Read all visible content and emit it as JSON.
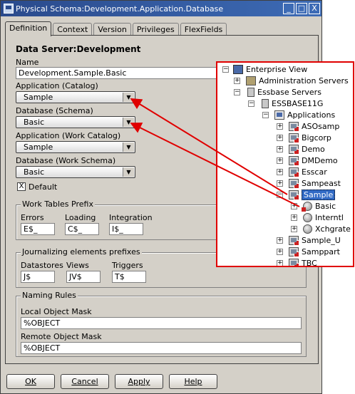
{
  "window": {
    "title": "Physical Schema:Development.Application.Database",
    "minimize": "_",
    "maximize": "□",
    "close": "X"
  },
  "tabs": [
    "Definition",
    "Context",
    "Version",
    "Privileges",
    "FlexFields"
  ],
  "form": {
    "heading": "Data Server:Development",
    "name_label": "Name",
    "name_value": "Development.Sample.Basic",
    "app_catalog_label": "Application (Catalog)",
    "app_catalog_value": "Sample",
    "db_schema_label": "Database (Schema)",
    "db_schema_value": "Basic",
    "app_work_catalog_label": "Application (Work Catalog)",
    "app_work_catalog_value": "Sample",
    "db_work_schema_label": "Database (Work Schema)",
    "db_work_schema_value": "Basic",
    "default_label": "Default",
    "default_checked": "X"
  },
  "work_tables": {
    "title": "Work Tables Prefix",
    "errors_label": "Errors",
    "errors_value": "E$_",
    "loading_label": "Loading",
    "loading_value": "C$_",
    "integration_label": "Integration",
    "integration_value": "I$_"
  },
  "journalizing": {
    "title": "Journalizing elements prefixes",
    "datastores_label": "Datastores",
    "datastores_value": "J$",
    "views_label": "Views",
    "views_value": "JV$",
    "triggers_label": "Triggers",
    "triggers_value": "T$"
  },
  "naming": {
    "title": "Naming Rules",
    "local_label": "Local Object Mask",
    "local_value": "%OBJECT",
    "remote_label": "Remote Object Mask",
    "remote_value": "%OBJECT"
  },
  "buttons": {
    "ok": "OK",
    "cancel": "Cancel",
    "apply": "Apply",
    "help": "Help"
  },
  "tree": {
    "enterprise_view": "Enterprise View",
    "admin_servers": "Administration Servers",
    "essbase_servers": "Essbase Servers",
    "server": "ESSBASE11G",
    "applications": "Applications",
    "apps": [
      "ASOsamp",
      "Bigcorp",
      "Demo",
      "DMDemo",
      "Esscar",
      "Sampeast",
      "Sample",
      "Sample_U",
      "Samppart",
      "TBC"
    ],
    "databases": [
      "Basic",
      "Interntl",
      "Xchgrate"
    ]
  },
  "colors": {
    "highlight_border": "#e00000",
    "selection": "#316ac5",
    "dialog_bg": "#d4d0c8",
    "title_bar": "#2a4a8c"
  }
}
